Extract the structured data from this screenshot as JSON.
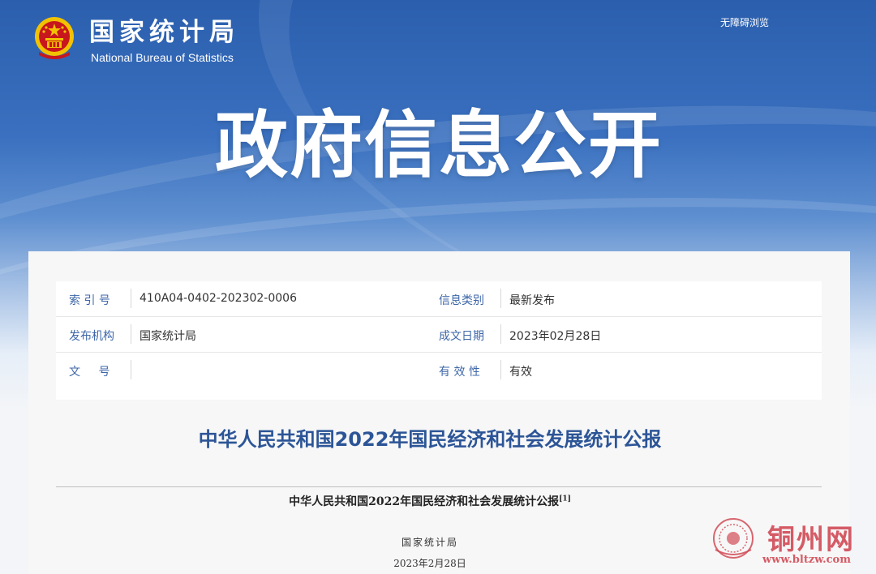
{
  "header": {
    "site_name_cn": "国家统计局",
    "site_name_en": "National Bureau of Statistics",
    "accessibility_link": "无障碍浏览",
    "hero_title": "政府信息公开"
  },
  "meta": {
    "index_label": "索 引 号",
    "index_value": "410A04-0402-202302-0006",
    "category_label": "信息类别",
    "category_value": "最新发布",
    "publisher_label": "发布机构",
    "publisher_value": "国家统计局",
    "date_label": "成文日期",
    "date_value": "2023年02月28日",
    "doc_number_label": "文 号",
    "doc_number_value": "",
    "validity_label": "有 效 性",
    "validity_value": "有效"
  },
  "document": {
    "title": "中华人民共和国2022年国民经济和社会发展统计公报",
    "subtitle": "中华人民共和国2022年国民经济和社会发展统计公报",
    "footnote_marker": "[1]",
    "issuer": "国家统计局",
    "issue_date": "2023年2月28日"
  },
  "watermark": {
    "name": "铜州网",
    "url": "www.bltzw.com"
  },
  "colors": {
    "banner_blue": "#2b5fae",
    "label_blue": "#3d66a8",
    "title_blue": "#2c5597",
    "emblem_red": "#c8161d",
    "emblem_gold": "#f2c200",
    "watermark_red": "#d14b56"
  }
}
